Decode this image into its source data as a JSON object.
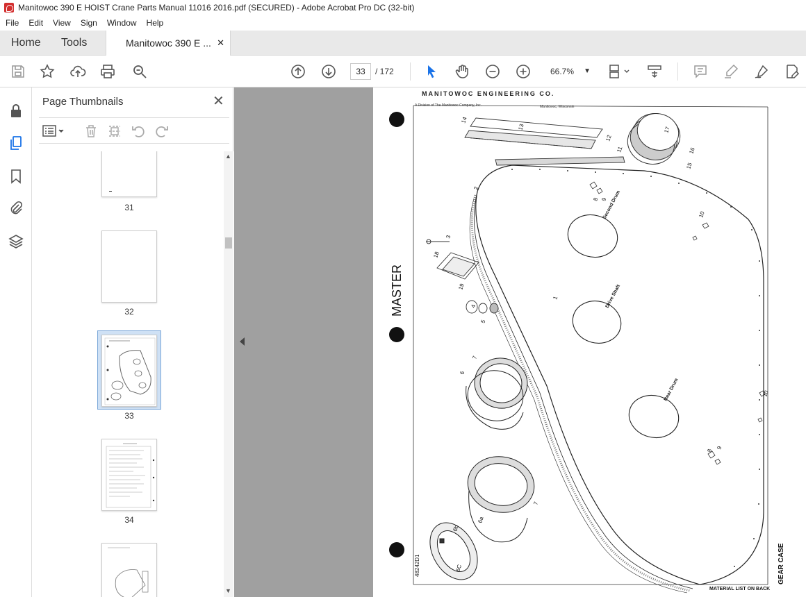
{
  "window": {
    "title": "Manitowoc 390 E HOIST Crane Parts Manual 11016 2016.pdf (SECURED) - Adobe Acrobat Pro DC (32-bit)"
  },
  "menu": [
    "File",
    "Edit",
    "View",
    "Sign",
    "Window",
    "Help"
  ],
  "nav": {
    "home": "Home",
    "tools": "Tools"
  },
  "tab": {
    "label": "Manitowoc 390 E ...",
    "close": "✕"
  },
  "toolbar": {
    "current_page": "33",
    "total_pages": "/ 172",
    "zoom": "66.7%"
  },
  "thumbnails": {
    "title": "Page Thumbnails",
    "close": "✕",
    "pages": [
      {
        "label": "31"
      },
      {
        "label": "32"
      },
      {
        "label": "33",
        "selected": true
      },
      {
        "label": "34"
      }
    ]
  },
  "document": {
    "header_company": "MANITOWOC ENGINEERING CO.",
    "header_division": "A Division of The Manitowoc Company, Inc.",
    "header_location": "Manitowoc, Wisconsin",
    "side_label": "MASTER",
    "drawing_number": "48242D1",
    "footer_note": "MATERIAL LIST ON BACK",
    "corner_title": "GEAR CASE",
    "labels": {
      "second_drum": "Second Drum",
      "drive_shaft": "Drive Shaft",
      "rear_drum": "Rear Drum"
    },
    "callouts": [
      "14",
      "13",
      "12",
      "11",
      "17",
      "16",
      "15",
      "2",
      "8",
      "9",
      "10",
      "3",
      "18",
      "19",
      "1",
      "4",
      "5",
      "7",
      "6",
      "10",
      "8",
      "9",
      "7",
      "6a",
      "6b",
      "6C"
    ]
  },
  "colors": {
    "accent": "#1a73e8",
    "selection": "#cfe1f5",
    "gutter": "#a0a0a0"
  }
}
